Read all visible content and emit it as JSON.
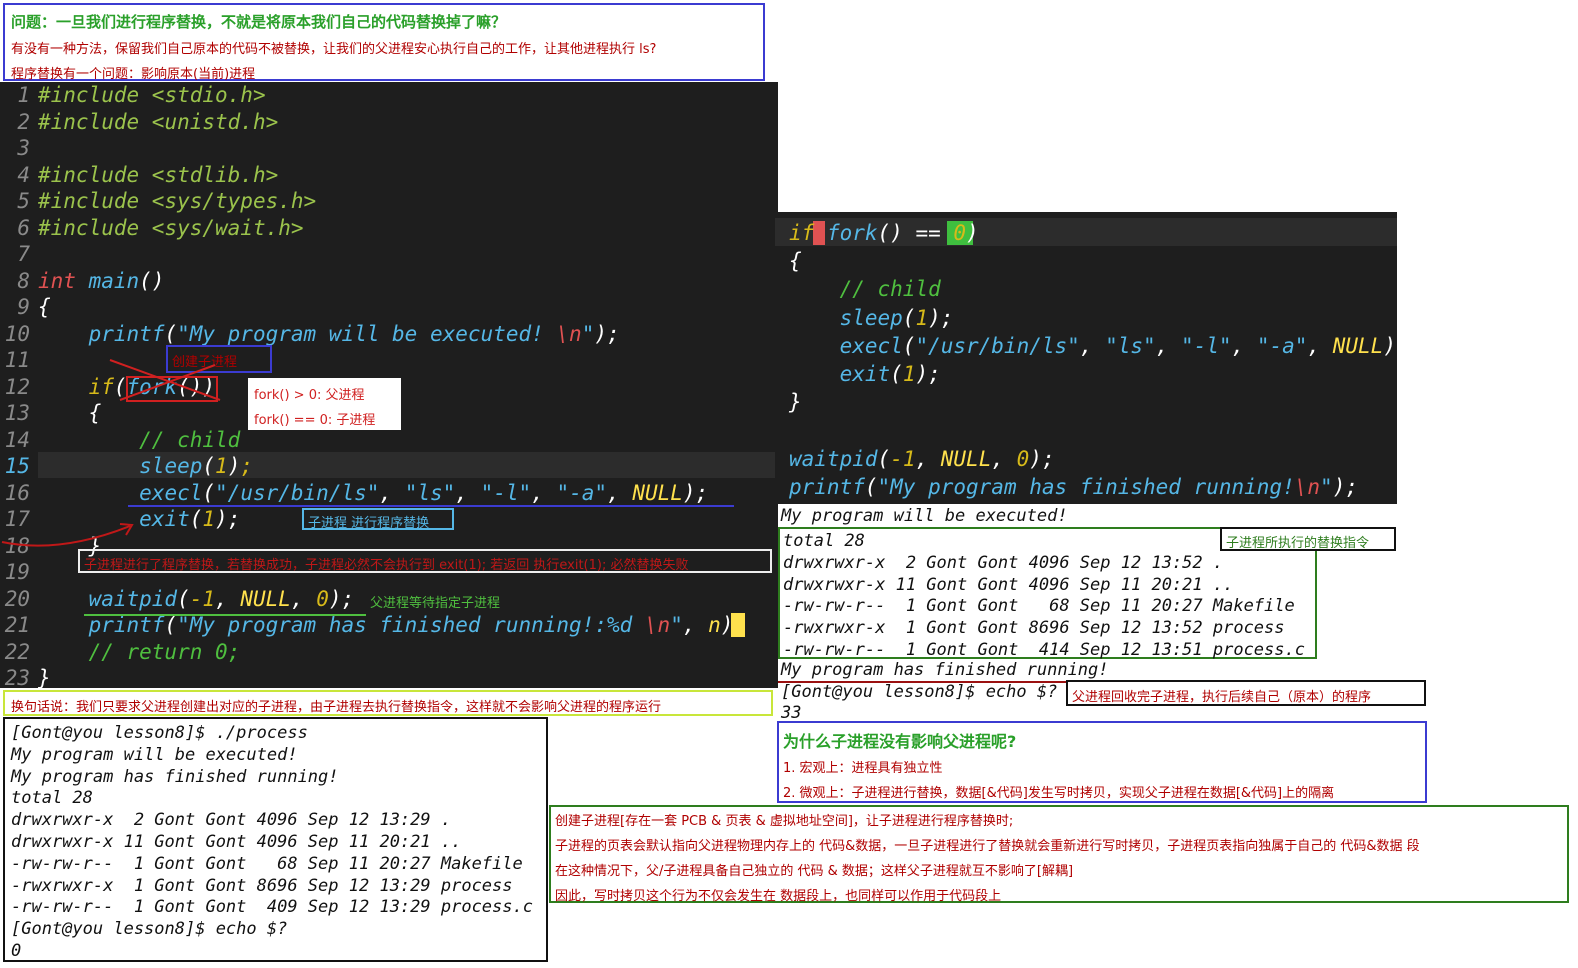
{
  "question_box": {
    "title": "问题：一旦我们进行程序替换，不就是将原本我们自己的代码替换掉了嘛？",
    "line2": "有没有一种方法，保留我们自己原本的代码不被替换，让我们的父进程安心执行自己的工作，让其他进程执行 ls?",
    "line3": "程序替换有一个问题：影响原本(当前)进程"
  },
  "left_code": {
    "lines": [
      {
        "n": "1",
        "parts": [
          [
            "pp",
            "#include "
          ],
          [
            "pp",
            "<stdio.h>"
          ]
        ]
      },
      {
        "n": "2",
        "parts": [
          [
            "pp",
            "#include "
          ],
          [
            "pp",
            "<unistd.h>"
          ]
        ]
      },
      {
        "n": "3",
        "parts": []
      },
      {
        "n": "4",
        "parts": [
          [
            "pp",
            "#include "
          ],
          [
            "pp",
            "<stdlib.h>"
          ]
        ]
      },
      {
        "n": "5",
        "parts": [
          [
            "pp",
            "#include "
          ],
          [
            "pp",
            "<sys/types.h>"
          ]
        ]
      },
      {
        "n": "6",
        "parts": [
          [
            "pp",
            "#include "
          ],
          [
            "pp",
            "<sys/wait.h>"
          ]
        ]
      },
      {
        "n": "7",
        "parts": []
      },
      {
        "n": "8",
        "parts": [
          [
            "ty",
            "int "
          ],
          [
            "fn",
            "main"
          ],
          [
            "wh",
            "()"
          ]
        ]
      },
      {
        "n": "9",
        "parts": [
          [
            "wh",
            "{"
          ]
        ]
      },
      {
        "n": "10",
        "parts": [
          [
            "wh",
            "    "
          ],
          [
            "fn",
            "printf"
          ],
          [
            "wh",
            "("
          ],
          [
            "str",
            "\"My program will be executed! "
          ],
          [
            "esc",
            "\\n"
          ],
          [
            "str",
            "\""
          ],
          [
            "wh",
            ");"
          ]
        ]
      },
      {
        "n": "11",
        "parts": []
      },
      {
        "n": "12",
        "parts": [
          [
            "wh",
            "    "
          ],
          [
            "kw",
            "if"
          ],
          [
            "wh",
            "("
          ],
          [
            "fn",
            "fork"
          ],
          [
            "wh",
            "())"
          ]
        ]
      },
      {
        "n": "13",
        "parts": [
          [
            "wh",
            "    {"
          ]
        ]
      },
      {
        "n": "14",
        "parts": [
          [
            "wh",
            "        "
          ],
          [
            "cm",
            "// child"
          ]
        ]
      },
      {
        "n": "15",
        "parts": [
          [
            "wh",
            "        "
          ],
          [
            "fn",
            "sleep"
          ],
          [
            "wh",
            "("
          ],
          [
            "num",
            "1"
          ],
          [
            "wh",
            ")"
          ],
          [
            "num",
            ";"
          ]
        ]
      },
      {
        "n": "16",
        "parts": [
          [
            "wh",
            "        "
          ],
          [
            "fn",
            "execl"
          ],
          [
            "wh",
            "("
          ],
          [
            "str",
            "\"/usr/bin/ls\""
          ],
          [
            "wh",
            ", "
          ],
          [
            "str",
            "\"ls\""
          ],
          [
            "wh",
            ", "
          ],
          [
            "str",
            "\"-l\""
          ],
          [
            "wh",
            ", "
          ],
          [
            "str",
            "\"-a\""
          ],
          [
            "wh",
            ", "
          ],
          [
            "nul",
            "NULL"
          ],
          [
            "wh",
            ");"
          ]
        ]
      },
      {
        "n": "17",
        "parts": [
          [
            "wh",
            "        "
          ],
          [
            "fn",
            "exit"
          ],
          [
            "wh",
            "("
          ],
          [
            "num",
            "1"
          ],
          [
            "wh",
            ");"
          ]
        ]
      },
      {
        "n": "18",
        "parts": [
          [
            "wh",
            "    }"
          ]
        ]
      },
      {
        "n": "19",
        "parts": []
      },
      {
        "n": "20",
        "parts": [
          [
            "wh",
            "    "
          ],
          [
            "fn",
            "waitpid"
          ],
          [
            "wh",
            "("
          ],
          [
            "num",
            "-1"
          ],
          [
            "wh",
            ", "
          ],
          [
            "nul",
            "NULL"
          ],
          [
            "wh",
            ", "
          ],
          [
            "num",
            "0"
          ],
          [
            "wh",
            ");"
          ]
        ]
      },
      {
        "n": "21",
        "parts": [
          [
            "wh",
            "    "
          ],
          [
            "fn",
            "printf"
          ],
          [
            "wh",
            "("
          ],
          [
            "str",
            "\"My program has finished running!:%d "
          ],
          [
            "esc",
            "\\n"
          ],
          [
            "str",
            "\""
          ],
          [
            "wh",
            ", "
          ],
          [
            "nul",
            "n"
          ],
          [
            "wh",
            ");"
          ]
        ]
      },
      {
        "n": "22",
        "parts": [
          [
            "wh",
            "    "
          ],
          [
            "cm",
            "// return 0;"
          ]
        ]
      },
      {
        "n": "23",
        "parts": [
          [
            "wh",
            "}"
          ]
        ]
      }
    ]
  },
  "left_annotations": {
    "create_child": "创建子进程",
    "fork_gt0": "fork() > 0:  父进程",
    "fork_eq0": "fork() == 0:  子进程",
    "child_replace": "子进程 进行程序替换",
    "child_note": "子进程进行了程序替换，若替换成功，子进程必然不会执行到 exit(1); 若返回 执行exit(1); 必然替换失败",
    "parent_wait": "父进程等待指定子进程",
    "summary": "换句话说：我们只要求父进程创建出对应的子进程，由子进程去执行替换指令，这样就不会影响父进程的程序运行"
  },
  "left_terminal": {
    "lines": [
      "[Gont@you lesson8]$ ./process",
      "My program will be executed!",
      "My program has finished running!",
      "total 28",
      "drwxrwxr-x  2 Gont Gont 4096 Sep 12 13:29 .",
      "drwxrwxr-x 11 Gont Gont 4096 Sep 11 20:21 ..",
      "-rw-rw-r--  1 Gont Gont   68 Sep 11 20:27 Makefile",
      "-rwxrwxr-x  1 Gont Gont 8696 Sep 12 13:29 process",
      "-rw-rw-r--  1 Gont Gont  409 Sep 12 13:29 process.c",
      "[Gont@you lesson8]$ echo $?",
      "0"
    ]
  },
  "right_code": {
    "lines": [
      [
        [
          "kw",
          "if"
        ],
        [
          "esc",
          "("
        ],
        [
          "fn",
          "fork"
        ],
        [
          "wh",
          "() == "
        ],
        [
          "num",
          "0"
        ],
        [
          "wh",
          ")"
        ]
      ],
      [
        [
          "wh",
          "{"
        ]
      ],
      [
        [
          "wh",
          "    "
        ],
        [
          "cm",
          "// child"
        ]
      ],
      [
        [
          "wh",
          "    "
        ],
        [
          "fn",
          "sleep"
        ],
        [
          "wh",
          "("
        ],
        [
          "num",
          "1"
        ],
        [
          "wh",
          ");"
        ]
      ],
      [
        [
          "wh",
          "    "
        ],
        [
          "fn",
          "execl"
        ],
        [
          "wh",
          "("
        ],
        [
          "str",
          "\"/usr/bin/ls\""
        ],
        [
          "wh",
          ", "
        ],
        [
          "str",
          "\"ls\""
        ],
        [
          "wh",
          ", "
        ],
        [
          "str",
          "\"-l\""
        ],
        [
          "wh",
          ", "
        ],
        [
          "str",
          "\"-a\""
        ],
        [
          "wh",
          ", "
        ],
        [
          "nul",
          "NULL"
        ],
        [
          "wh",
          ");"
        ]
      ],
      [
        [
          "wh",
          "    "
        ],
        [
          "fn",
          "exit"
        ],
        [
          "wh",
          "("
        ],
        [
          "num",
          "1"
        ],
        [
          "wh",
          ");"
        ]
      ],
      [
        [
          "wh",
          "}"
        ]
      ],
      [],
      [
        [
          "fn",
          "waitpid"
        ],
        [
          "wh",
          "("
        ],
        [
          "num",
          "-1"
        ],
        [
          "wh",
          ", "
        ],
        [
          "nul",
          "NULL"
        ],
        [
          "wh",
          ", "
        ],
        [
          "num",
          "0"
        ],
        [
          "wh",
          ");"
        ]
      ],
      [
        [
          "fn",
          "printf"
        ],
        [
          "wh",
          "("
        ],
        [
          "str",
          "\"My program has finished running!"
        ],
        [
          "esc",
          "\\n"
        ],
        [
          "str",
          "\""
        ],
        [
          "wh",
          ");"
        ]
      ]
    ]
  },
  "right_terminal": {
    "line_executed": "My program will be executed!",
    "ls_lines": [
      "total 28",
      "drwxrwxr-x  2 Gont Gont 4096 Sep 12 13:52 .",
      "drwxrwxr-x 11 Gont Gont 4096 Sep 11 20:21 ..",
      "-rw-rw-r--  1 Gont Gont   68 Sep 11 20:27 Makefile",
      "-rwxrwxr-x  1 Gont Gont 8696 Sep 12 13:52 process",
      "-rw-rw-r--  1 Gont Gont  414 Sep 12 13:51 process.c"
    ],
    "line_finished": "My program has finished running!",
    "line_echo": "[Gont@you lesson8]$ echo $?",
    "line_code": "33"
  },
  "right_annotations": {
    "child_cmd": "子进程所执行的替换指令",
    "parent_recycle": "父进程回收完子进程，执行后续自己（原本）的程序"
  },
  "why_box": {
    "title": "为什么子进程没有影响父进程呢?",
    "line1": "1. 宏观上：进程具有独立性",
    "line2": "2. 微观上：子进程进行替换，数据[&代码]发生写时拷贝，实现父子进程在数据[&代码]上的隔离"
  },
  "explain_box": {
    "line1": "创建子进程[存在一套 PCB & 页表 & 虚拟地址空间]，让子进程进行程序替换时;",
    "line2": "子进程的页表会默认指向父进程物理内存上的 代码&数据，一旦子进程进行了替换就会重新进行写时拷贝，子进程页表指向独属于自己的 代码&数据 段",
    "line3": "在这种情况下，父/子进程具备自己独立的 代码 & 数据；这样父子进程就互不影响了[解耦]",
    "line4": "因此，写时拷贝这个行为不仅会发生在 数据段上，也同样可以作用于代码段上"
  },
  "colors": {
    "editor_bg": "#1e1e1e",
    "note_red": "#b00000",
    "title_green": "#2aa02a",
    "box_blue": "#3b3bd1",
    "box_green": "#2e7d1e"
  }
}
